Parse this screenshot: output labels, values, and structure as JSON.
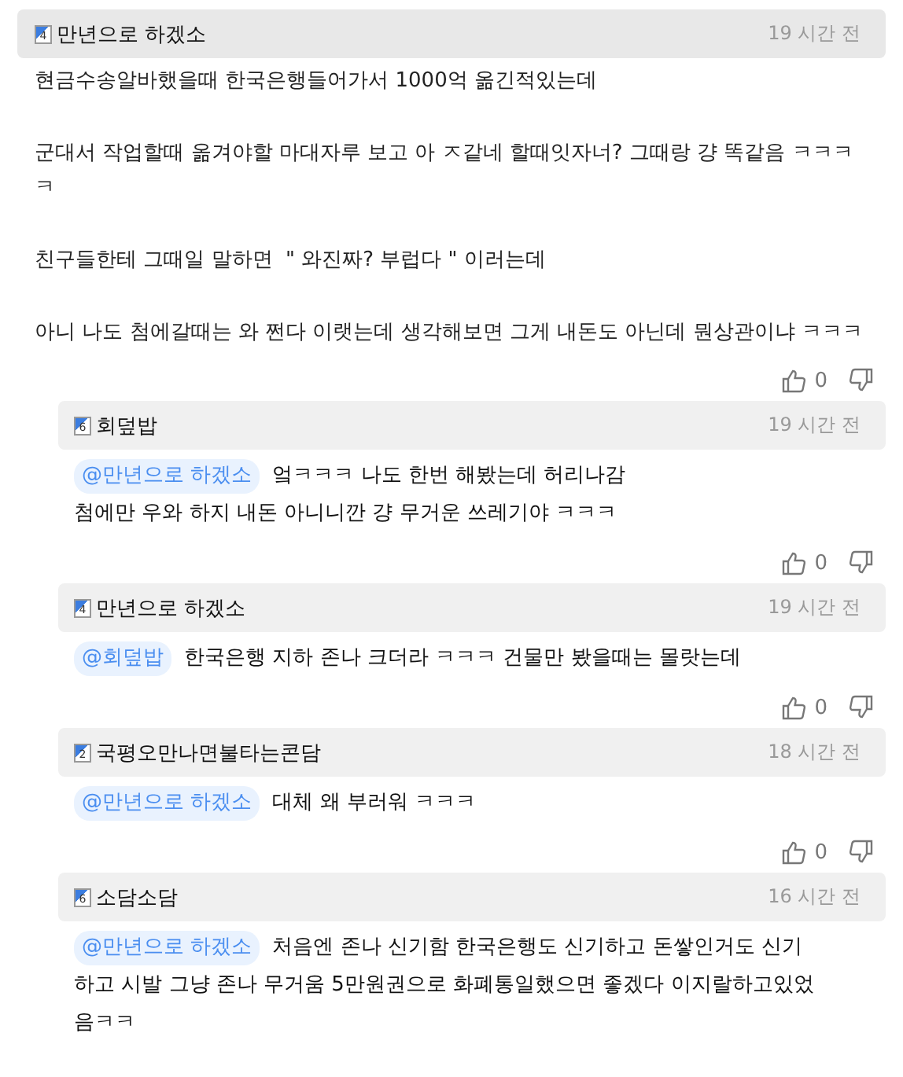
{
  "comment": {
    "author": "만년으로 하겠소",
    "level": "4",
    "time": "19 시간 전",
    "paragraphs": [
      "현금수송알바했을때 한국은행들어가서 1000억 옮긴적있는데",
      "군대서 작업할때 옮겨야할 마대자루 보고 아 ㅈ같네 할때잇자너? 그때랑 걍 똑같음 ㅋㅋㅋㅋ",
      "친구들한테 그때일 말하면  \" 와진짜? 부럽다 \" 이러는데",
      "아니 나도 첨에갈때는 와 쩐다 이랫는데 생각해보면 그게 내돈도 아닌데 뭔상관이냐 ㅋㅋㅋ"
    ],
    "likes": "0"
  },
  "replies": [
    {
      "author": "회덮밥",
      "level": "6",
      "time": "19 시간 전",
      "mention": "@만년으로 하겠소",
      "lines": [
        "엌ㅋㅋㅋ 나도 한번 해봤는데 허리나감",
        "첨에만 우와 하지 내돈 아니니깐 걍 무거운 쓰레기야 ㅋㅋㅋ"
      ],
      "likes": "0"
    },
    {
      "author": "만년으로 하겠소",
      "level": "4",
      "time": "19 시간 전",
      "mention": "@회덮밥",
      "lines": [
        "한국은행 지하 존나 크더라 ㅋㅋㅋ 건물만 봤을때는 몰랏는데"
      ],
      "likes": "0"
    },
    {
      "author": "국평오만나면불타는콘담",
      "level": "2",
      "time": "18 시간 전",
      "mention": "@만년으로 하겠소",
      "lines": [
        "대체 왜 부러워 ㅋㅋㅋ"
      ],
      "likes": "0"
    },
    {
      "author": "소담소담",
      "level": "6",
      "time": "16 시간 전",
      "mention": "@만년으로 하겠소",
      "lines": [
        "처음엔 존나 신기함 한국은행도 신기하고 돈쌓인거도 신기",
        "하고 시발 그냥 존나 무거움 5만원권으로 화폐통일했으면 좋겠다 이지랄하고있었",
        "음ㅋㅋ"
      ]
    }
  ]
}
